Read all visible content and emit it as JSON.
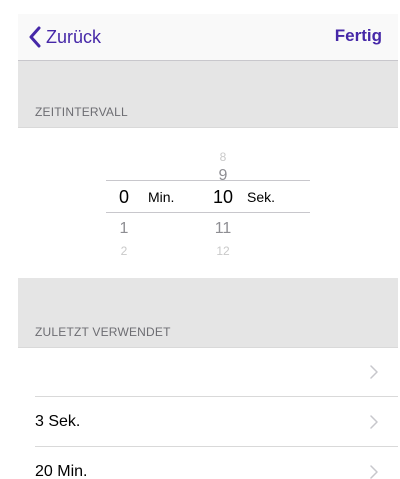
{
  "navbar": {
    "back_label": "Zurück",
    "done_label": "Fertig",
    "accent_color": "#4628a8"
  },
  "interval_section": {
    "header": "ZEITINTERVALL"
  },
  "picker": {
    "minutes": {
      "above_near": "",
      "selected": "0",
      "below_near": "1",
      "below_far": "2",
      "unit": "Min."
    },
    "seconds": {
      "above_far": "8",
      "above_near": "9",
      "selected": "10",
      "below_near": "11",
      "below_far": "12",
      "unit": "Sek."
    }
  },
  "recent_section": {
    "header": "ZULETZT VERWENDET",
    "items": [
      {
        "label": ""
      },
      {
        "label": "3 Sek."
      },
      {
        "label": "20 Min."
      }
    ]
  },
  "icons": {
    "back": "chevron-left-icon",
    "row": "chevron-right-icon"
  }
}
